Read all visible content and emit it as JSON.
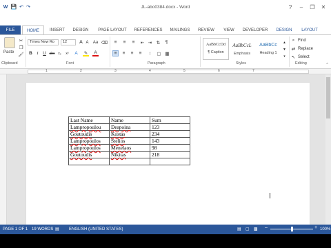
{
  "window": {
    "title": "JL-abo0384.docx - Word"
  },
  "title_controls": [
    "?",
    "–",
    "❐",
    "✕"
  ],
  "quick_access": [
    "save-icon",
    "undo-icon",
    "redo-icon"
  ],
  "tabs": [
    "FILE",
    "HOME",
    "INSERT",
    "DESIGN",
    "PAGE LAYOUT",
    "REFERENCES",
    "MAILINGS",
    "REVIEW",
    "VIEW",
    "DEVELOPER",
    "DESIGN",
    "LAYOUT"
  ],
  "ribbon": {
    "clipboard": {
      "label": "Clipboard",
      "paste": "Paste"
    },
    "font": {
      "label": "Font",
      "family": "Times New Ro",
      "size": "12"
    },
    "paragraph": {
      "label": "Paragraph"
    },
    "styles": {
      "label": "Styles",
      "items": [
        {
          "sample": "AaBbCcDd",
          "name": "¶ Caption"
        },
        {
          "sample": "AaBbCcL",
          "name": "Emphasis"
        },
        {
          "sample": "AaBbCc",
          "name": "Heading 1"
        }
      ]
    },
    "editing": {
      "label": "Editing",
      "find": "Find",
      "replace": "Replace",
      "select": "Select"
    }
  },
  "ruler": {
    "marks": [
      "1",
      "2",
      "3",
      "4",
      "5",
      "6",
      "7"
    ]
  },
  "table": {
    "headers": [
      "Last Name",
      "Name",
      "Sum"
    ],
    "rows": [
      [
        "Lampropoulou",
        "Despoina",
        "123"
      ],
      [
        "Goutoudis",
        "Kostas",
        "234"
      ],
      [
        "Lampropoulos",
        "Stelios",
        "143"
      ],
      [
        "Lampropoulos",
        "Menelaos",
        "98"
      ],
      [
        "Goutoudis",
        "Nikitas",
        "218"
      ],
      [
        "",
        "",
        ""
      ]
    ]
  },
  "status": {
    "page": "PAGE 1 OF 1",
    "words": "19 WORDS",
    "language": "ENGLISH (UNITED STATES)",
    "zoom": "100%"
  },
  "colors": {
    "accent": "#2b579a"
  }
}
